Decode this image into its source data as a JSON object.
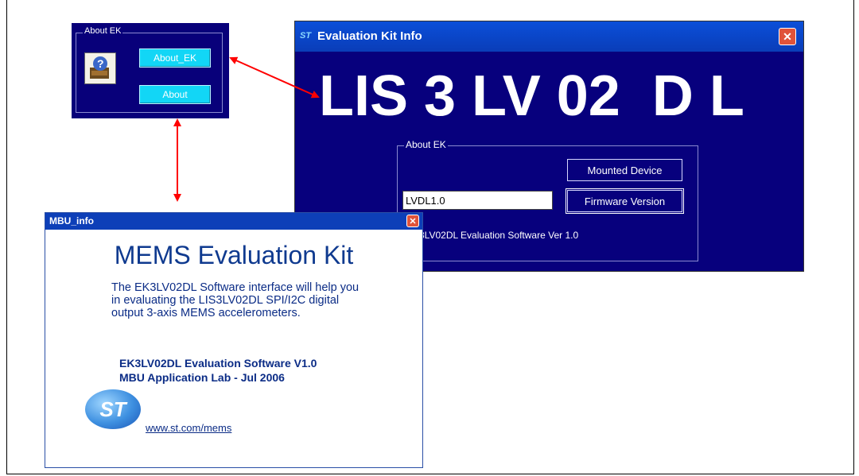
{
  "small_panel": {
    "group_label": "About EK",
    "icon": "help-computer-icon",
    "buttons": {
      "about_ek": "About_EK",
      "about": "About"
    }
  },
  "eki_window": {
    "title": "Evaluation Kit Info",
    "title_icon": "ST",
    "close_icon": "close-icon",
    "big_text": "LIS 3 LV 02  D L",
    "group_label": "About EK",
    "mounted_device_button": "Mounted Device",
    "firmware_version_button": "Firmware Version",
    "input_value": "LVDL1.0",
    "software_version_text": "EK3LV02DL Evaluation Software Ver 1.0"
  },
  "mbu_window": {
    "title": "MBU_info",
    "close_icon": "close-icon",
    "heading": "MEMS Evaluation Kit",
    "description": "The EK3LV02DL Software interface will help you in evaluating the LIS3LV02DL SPI/I2C digital output 3-axis MEMS accelerometers.",
    "software_line": "EK3LV02DL Evaluation Software V1.0",
    "lab_line": "MBU Application Lab - Jul 2006",
    "logo_text": "ST",
    "link": "www.st.com/mems"
  },
  "colors": {
    "panel_navy": "#07007d",
    "button_cyan": "#12d6f6",
    "titlebar_blue": "#0b4fd9",
    "arrow_red": "#ff0000",
    "text_blue": "#0b2c86"
  }
}
